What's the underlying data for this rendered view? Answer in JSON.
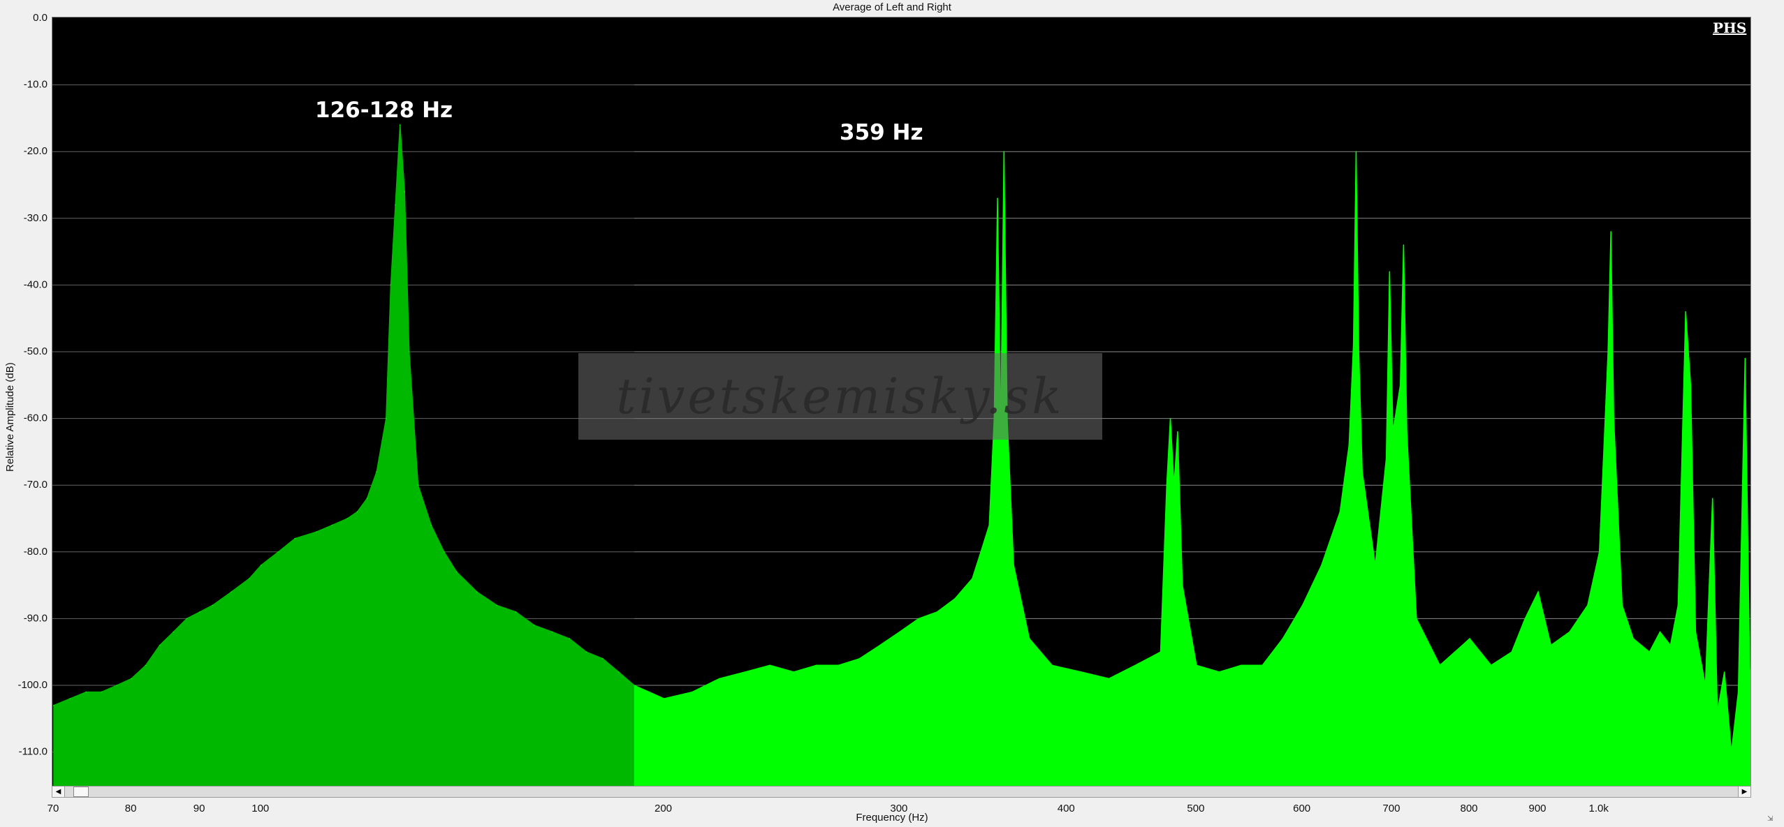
{
  "chart_data": {
    "type": "area",
    "title": "Average of Left and Right",
    "xlabel": "Frequency (Hz)",
    "ylabel": "Relative Amplitude (dB)",
    "x_scale": "log",
    "xlim": [
      70,
      1300
    ],
    "ylim": [
      -115,
      0
    ],
    "grid": true,
    "y_ticks": [
      "0.0",
      "-10.0",
      "-20.0",
      "-30.0",
      "-40.0",
      "-50.0",
      "-60.0",
      "-70.0",
      "-80.0",
      "-90.0",
      "-100.0",
      "-110.0"
    ],
    "y_tick_values": [
      0,
      -10,
      -20,
      -30,
      -40,
      -50,
      -60,
      -70,
      -80,
      -90,
      -100,
      -110
    ],
    "x_ticks": [
      "70",
      "80",
      "90",
      "100",
      "200",
      "300",
      "400",
      "500",
      "600",
      "700",
      "800",
      "900",
      "1.0k"
    ],
    "x_tick_values": [
      70,
      80,
      90,
      100,
      200,
      300,
      400,
      500,
      600,
      700,
      800,
      900,
      1000
    ],
    "series": [
      {
        "color": "#00ff00",
        "points": [
          [
            70,
            -103
          ],
          [
            72,
            -102
          ],
          [
            74,
            -101
          ],
          [
            76,
            -101
          ],
          [
            78,
            -100
          ],
          [
            80,
            -99
          ],
          [
            82,
            -97
          ],
          [
            84,
            -94
          ],
          [
            86,
            -92
          ],
          [
            88,
            -90
          ],
          [
            90,
            -89
          ],
          [
            92,
            -88
          ],
          [
            95,
            -86
          ],
          [
            98,
            -84
          ],
          [
            100,
            -82
          ],
          [
            103,
            -80
          ],
          [
            106,
            -78
          ],
          [
            110,
            -77
          ],
          [
            113,
            -76
          ],
          [
            116,
            -75
          ],
          [
            118,
            -74
          ],
          [
            120,
            -72
          ],
          [
            122,
            -68
          ],
          [
            124,
            -60
          ],
          [
            125,
            -40
          ],
          [
            126,
            -28
          ],
          [
            127,
            -16
          ],
          [
            128,
            -26
          ],
          [
            129,
            -50
          ],
          [
            131,
            -70
          ],
          [
            134,
            -76
          ],
          [
            137,
            -80
          ],
          [
            140,
            -83
          ],
          [
            145,
            -86
          ],
          [
            150,
            -88
          ],
          [
            155,
            -89
          ],
          [
            160,
            -91
          ],
          [
            165,
            -92
          ],
          [
            170,
            -93
          ],
          [
            175,
            -95
          ],
          [
            180,
            -96
          ],
          [
            185,
            -98
          ],
          [
            190,
            -100
          ],
          [
            200,
            -102
          ],
          [
            210,
            -101
          ],
          [
            220,
            -99
          ],
          [
            230,
            -98
          ],
          [
            240,
            -97
          ],
          [
            250,
            -98
          ],
          [
            260,
            -97
          ],
          [
            270,
            -97
          ],
          [
            280,
            -96
          ],
          [
            290,
            -94
          ],
          [
            300,
            -92
          ],
          [
            310,
            -90
          ],
          [
            320,
            -89
          ],
          [
            330,
            -87
          ],
          [
            340,
            -84
          ],
          [
            345,
            -80
          ],
          [
            350,
            -76
          ],
          [
            353,
            -60
          ],
          [
            355,
            -27
          ],
          [
            357,
            -62
          ],
          [
            359,
            -20
          ],
          [
            361,
            -60
          ],
          [
            365,
            -82
          ],
          [
            375,
            -93
          ],
          [
            390,
            -97
          ],
          [
            410,
            -98
          ],
          [
            430,
            -99
          ],
          [
            450,
            -97
          ],
          [
            470,
            -95
          ],
          [
            475,
            -70
          ],
          [
            478,
            -60
          ],
          [
            481,
            -70
          ],
          [
            484,
            -62
          ],
          [
            488,
            -85
          ],
          [
            500,
            -97
          ],
          [
            520,
            -98
          ],
          [
            540,
            -97
          ],
          [
            560,
            -97
          ],
          [
            580,
            -93
          ],
          [
            600,
            -88
          ],
          [
            620,
            -82
          ],
          [
            640,
            -74
          ],
          [
            650,
            -64
          ],
          [
            655,
            -49
          ],
          [
            658,
            -20
          ],
          [
            661,
            -50
          ],
          [
            665,
            -68
          ],
          [
            680,
            -82
          ],
          [
            693,
            -66
          ],
          [
            697,
            -38
          ],
          [
            701,
            -62
          ],
          [
            710,
            -55
          ],
          [
            714,
            -34
          ],
          [
            718,
            -62
          ],
          [
            730,
            -90
          ],
          [
            760,
            -97
          ],
          [
            790,
            -94
          ],
          [
            800,
            -93
          ],
          [
            830,
            -97
          ],
          [
            860,
            -95
          ],
          [
            880,
            -90
          ],
          [
            900,
            -86
          ],
          [
            920,
            -94
          ],
          [
            950,
            -92
          ],
          [
            980,
            -88
          ],
          [
            1000,
            -80
          ],
          [
            1010,
            -60
          ],
          [
            1015,
            -50
          ],
          [
            1020,
            -32
          ],
          [
            1025,
            -60
          ],
          [
            1040,
            -88
          ],
          [
            1060,
            -93
          ],
          [
            1090,
            -95
          ],
          [
            1110,
            -92
          ],
          [
            1130,
            -94
          ],
          [
            1145,
            -88
          ],
          [
            1160,
            -44
          ],
          [
            1170,
            -55
          ],
          [
            1180,
            -92
          ],
          [
            1200,
            -100
          ],
          [
            1215,
            -72
          ],
          [
            1225,
            -104
          ],
          [
            1240,
            -98
          ],
          [
            1255,
            -110
          ],
          [
            1270,
            -101
          ],
          [
            1285,
            -51
          ],
          [
            1295,
            -97
          ],
          [
            1300,
            -103
          ]
        ]
      }
    ],
    "annotations": [
      {
        "text": "126-128 Hz",
        "x": 127,
        "y": -16
      },
      {
        "text": "359 Hz",
        "x": 359,
        "y": -20
      }
    ]
  },
  "logo_text": "PHS",
  "watermark_text": "tivetskemisky.sk"
}
